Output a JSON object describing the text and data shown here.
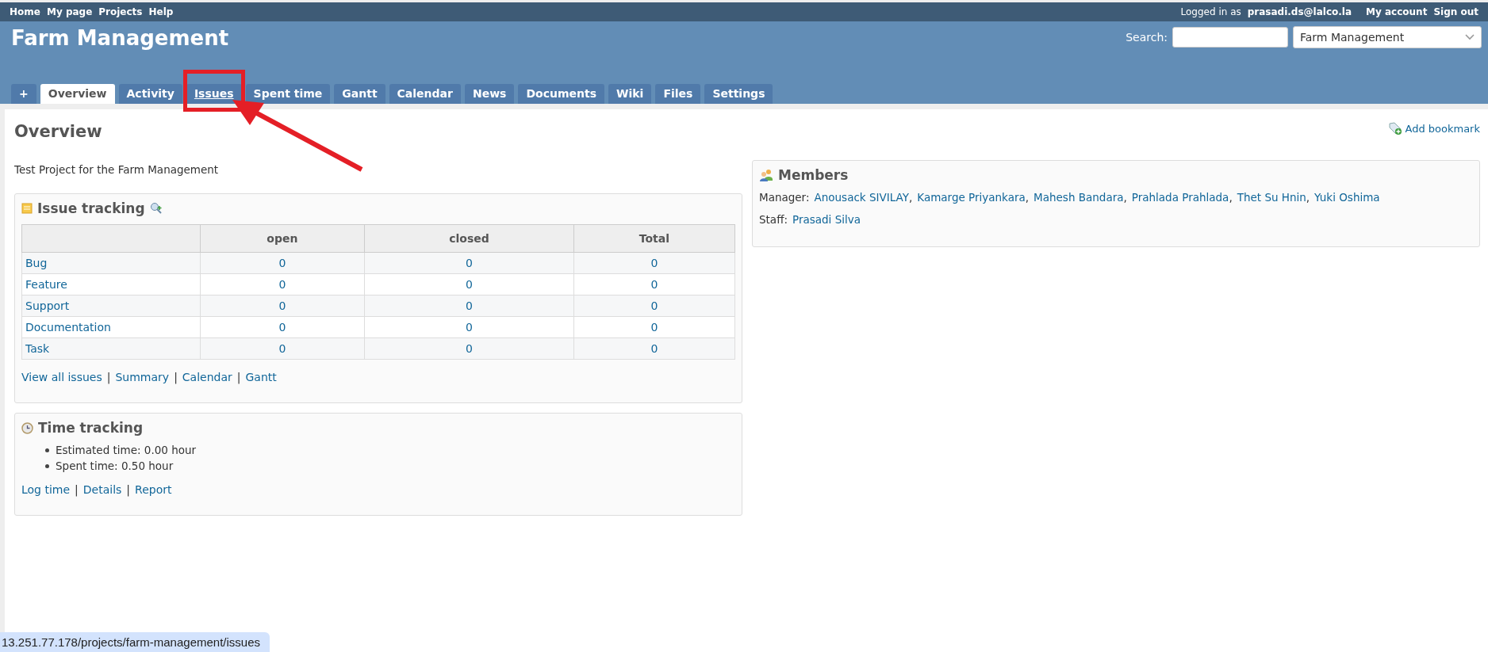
{
  "top_menu": {
    "left": [
      "Home",
      "My page",
      "Projects",
      "Help"
    ],
    "logged_in_label": "Logged in as",
    "user": "prasadi.ds@lalco.la",
    "right": [
      "My account",
      "Sign out"
    ]
  },
  "header": {
    "title": "Farm Management",
    "search_label": "Search:",
    "project_select": "Farm Management"
  },
  "tabs": [
    {
      "label": "+",
      "selected": false,
      "highlighted": false
    },
    {
      "label": "Overview",
      "selected": true,
      "highlighted": false
    },
    {
      "label": "Activity",
      "selected": false,
      "highlighted": false
    },
    {
      "label": "Issues",
      "selected": false,
      "highlighted": true
    },
    {
      "label": "Spent time",
      "selected": false,
      "highlighted": false
    },
    {
      "label": "Gantt",
      "selected": false,
      "highlighted": false
    },
    {
      "label": "Calendar",
      "selected": false,
      "highlighted": false
    },
    {
      "label": "News",
      "selected": false,
      "highlighted": false
    },
    {
      "label": "Documents",
      "selected": false,
      "highlighted": false
    },
    {
      "label": "Wiki",
      "selected": false,
      "highlighted": false
    },
    {
      "label": "Files",
      "selected": false,
      "highlighted": false
    },
    {
      "label": "Settings",
      "selected": false,
      "highlighted": false
    }
  ],
  "page": {
    "title": "Overview",
    "description": "Test Project for the Farm Management",
    "bookmark": "Add bookmark"
  },
  "issue_tracking": {
    "title": "Issue tracking",
    "columns": [
      "open",
      "closed",
      "Total"
    ],
    "rows": [
      {
        "tracker": "Bug",
        "open": "0",
        "closed": "0",
        "total": "0"
      },
      {
        "tracker": "Feature",
        "open": "0",
        "closed": "0",
        "total": "0"
      },
      {
        "tracker": "Support",
        "open": "0",
        "closed": "0",
        "total": "0"
      },
      {
        "tracker": "Documentation",
        "open": "0",
        "closed": "0",
        "total": "0"
      },
      {
        "tracker": "Task",
        "open": "0",
        "closed": "0",
        "total": "0"
      }
    ],
    "separator": "|",
    "links": [
      "View all issues",
      "Summary",
      "Calendar",
      "Gantt"
    ]
  },
  "time_tracking": {
    "title": "Time tracking",
    "items": [
      "Estimated time: 0.00 hour",
      "Spent time: 0.50 hour"
    ],
    "separator": "|",
    "links": [
      "Log time",
      "Details",
      "Report"
    ]
  },
  "members": {
    "title": "Members",
    "separator": ",",
    "roles": [
      {
        "role": "Manager:",
        "names": [
          "Anousack SIVILAY",
          "Kamarge Priyankara",
          "Mahesh Bandara",
          "Prahlada Prahlada",
          "Thet Su Hnin",
          "Yuki Oshima"
        ]
      },
      {
        "role": "Staff:",
        "names": [
          "Prasadi Silva"
        ]
      }
    ]
  },
  "status_bar": {
    "url": "13.251.77.178/projects/farm-management/issues"
  }
}
